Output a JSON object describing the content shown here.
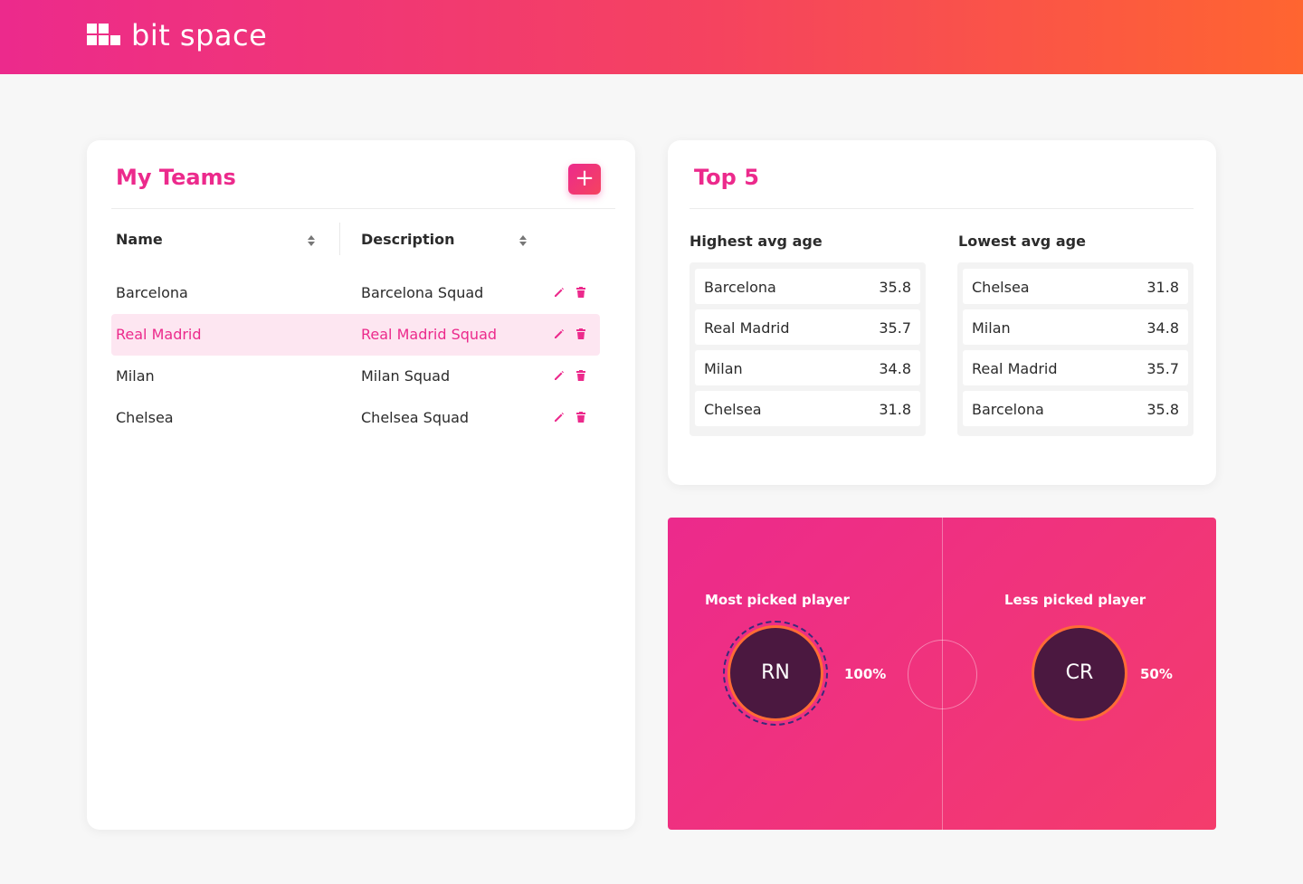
{
  "app": {
    "logo_text": "bit space",
    "accent_color": "#ec2a8c",
    "gradient_end": "#ff6530"
  },
  "teams": {
    "title": "My Teams",
    "add_button_label": "+",
    "columns": {
      "name": "Name",
      "description": "Description"
    },
    "rows": [
      {
        "name": "Barcelona",
        "description": "Barcelona Squad",
        "selected": false
      },
      {
        "name": "Real Madrid",
        "description": "Real Madrid Squad",
        "selected": true
      },
      {
        "name": "Milan",
        "description": "Milan Squad",
        "selected": false
      },
      {
        "name": "Chelsea",
        "description": "Chelsea Squad",
        "selected": false
      }
    ]
  },
  "top5": {
    "title": "Top 5",
    "highest": {
      "label": "Highest avg age",
      "items": [
        {
          "name": "Barcelona",
          "value": "35.8"
        },
        {
          "name": "Real Madrid",
          "value": "35.7"
        },
        {
          "name": "Milan",
          "value": "34.8"
        },
        {
          "name": "Chelsea",
          "value": "31.8"
        }
      ]
    },
    "lowest": {
      "label": "Lowest avg age",
      "items": [
        {
          "name": "Chelsea",
          "value": "31.8"
        },
        {
          "name": "Milan",
          "value": "34.8"
        },
        {
          "name": "Real Madrid",
          "value": "35.7"
        },
        {
          "name": "Barcelona",
          "value": "35.8"
        }
      ]
    }
  },
  "picks": {
    "most": {
      "label": "Most picked player",
      "initials": "RN",
      "percent": "100%"
    },
    "less": {
      "label": "Less picked player",
      "initials": "CR",
      "percent": "50%"
    }
  }
}
